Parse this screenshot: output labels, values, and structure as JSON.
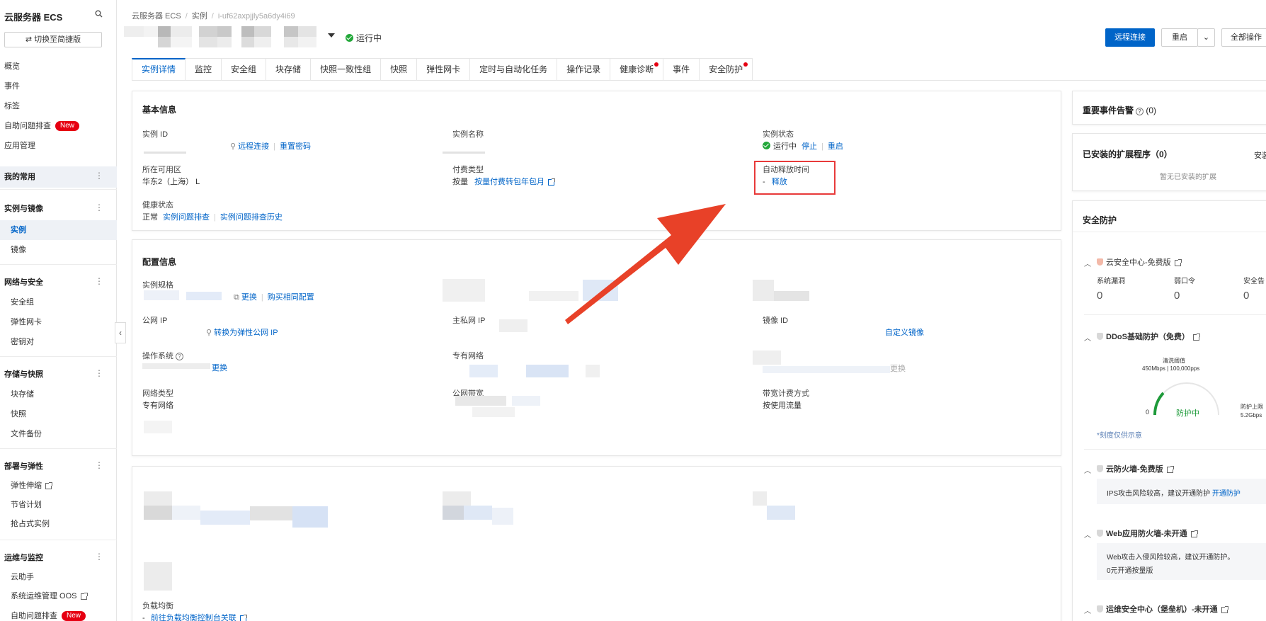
{
  "sidebar": {
    "title": "云服务器 ECS",
    "switch_label": "切换至简捷版",
    "top_items": [
      "概览",
      "事件",
      "标签",
      "自助问题排查",
      "应用管理"
    ],
    "badge_new": "New",
    "my_common": "我的常用",
    "groups": [
      {
        "label": "实例与镜像",
        "items": [
          "实例",
          "镜像"
        ]
      },
      {
        "label": "网络与安全",
        "items": [
          "安全组",
          "弹性网卡",
          "密钥对"
        ]
      },
      {
        "label": "存储与快照",
        "items": [
          "块存储",
          "快照",
          "文件备份"
        ]
      },
      {
        "label": "部署与弹性",
        "items": [
          "弹性伸缩",
          "节省计划",
          "抢占式实例"
        ]
      },
      {
        "label": "运维与监控",
        "items": [
          "云助手",
          "系统运维管理 OOS",
          "自助问题排查"
        ]
      }
    ]
  },
  "header": {
    "breadcrumb": [
      "云服务器 ECS",
      "实例",
      "i-uf62axpjjly5a6dy4i69"
    ],
    "status": "运行中",
    "buttons": {
      "remote": "远程连接",
      "restart": "重启",
      "all_ops": "全部操作"
    }
  },
  "tabs": [
    "实例详情",
    "监控",
    "安全组",
    "块存储",
    "快照一致性组",
    "快照",
    "弹性网卡",
    "定时与自动化任务",
    "操作记录",
    "健康诊断",
    "事件",
    "安全防护"
  ],
  "basic": {
    "title": "基本信息",
    "instance_id_label": "实例 ID",
    "remote_link": "远程连接",
    "reset_pwd": "重置密码",
    "name_label": "实例名称",
    "state_label": "实例状态",
    "state_value": "运行中",
    "stop_link": "停止",
    "restart_link": "重启",
    "zone_label": "所在可用区",
    "zone_value": "华东2（上海） L",
    "billing_label": "付费类型",
    "billing_value": "按量",
    "billing_link": "按量付费转包年包月",
    "release_label": "自动释放时间",
    "release_value": "-",
    "release_link": "释放",
    "health_label": "健康状态",
    "health_value": "正常",
    "health_link1": "实例问题排查",
    "health_link2": "实例问题排查历史"
  },
  "config": {
    "title": "配置信息",
    "spec_label": "实例规格",
    "spec_change": "更换",
    "spec_buy": "购买相同配置",
    "public_ip_label": "公网 IP",
    "eip_link": "转换为弹性公网 IP",
    "private_ip_label": "主私网 IP",
    "image_label": "镜像 ID",
    "custom_image": "自定义镜像",
    "os_label": "操作系统",
    "os_change": "更换",
    "vpc_label": "专有网络",
    "vpc_change": "更换",
    "net_type_label": "网络类型",
    "net_type_value": "专有网络",
    "bandwidth_label": "公网带宽",
    "bw_billing_label": "带宽计费方式",
    "bw_billing_value": "按使用流量"
  },
  "lb": {
    "label": "负载均衡",
    "value": "-",
    "link": "前往负载均衡控制台关联"
  },
  "right": {
    "events_title": "重要事件告警",
    "events_count": "(0)",
    "ext_title": "已安装的扩展程序（0）",
    "ext_install": "安装",
    "ext_empty": "暂无已安装的扩展",
    "sec_title": "安全防护",
    "sc_title": "云安全中心-免费版",
    "sc_cols": [
      "系统漏洞",
      "弱口令",
      "安全告"
    ],
    "sc_vals": [
      "0",
      "0",
      "0"
    ],
    "ddos_title": "DDoS基础防护（免费）",
    "ddos_threshold_label": "清洗阈值",
    "ddos_threshold": "450Mbps | 100,000pps",
    "ddos_zero": "0",
    "ddos_status": "防护中",
    "ddos_upper_label": "防护上限",
    "ddos_upper": "5.2Gbps",
    "ddos_note": "*刻度仅供示意",
    "fw_title": "云防火墙-免费版",
    "fw_msg": "IPS攻击风险较高，建议开通防护",
    "fw_link": "开通防护",
    "waf_title": "Web应用防火墙-未开通",
    "waf_msg": "Web攻击入侵风险较高，建议开通防护。",
    "waf_link": "0元开通按量版",
    "bastion_title": "运维安全中心（堡垒机）-未开通"
  }
}
